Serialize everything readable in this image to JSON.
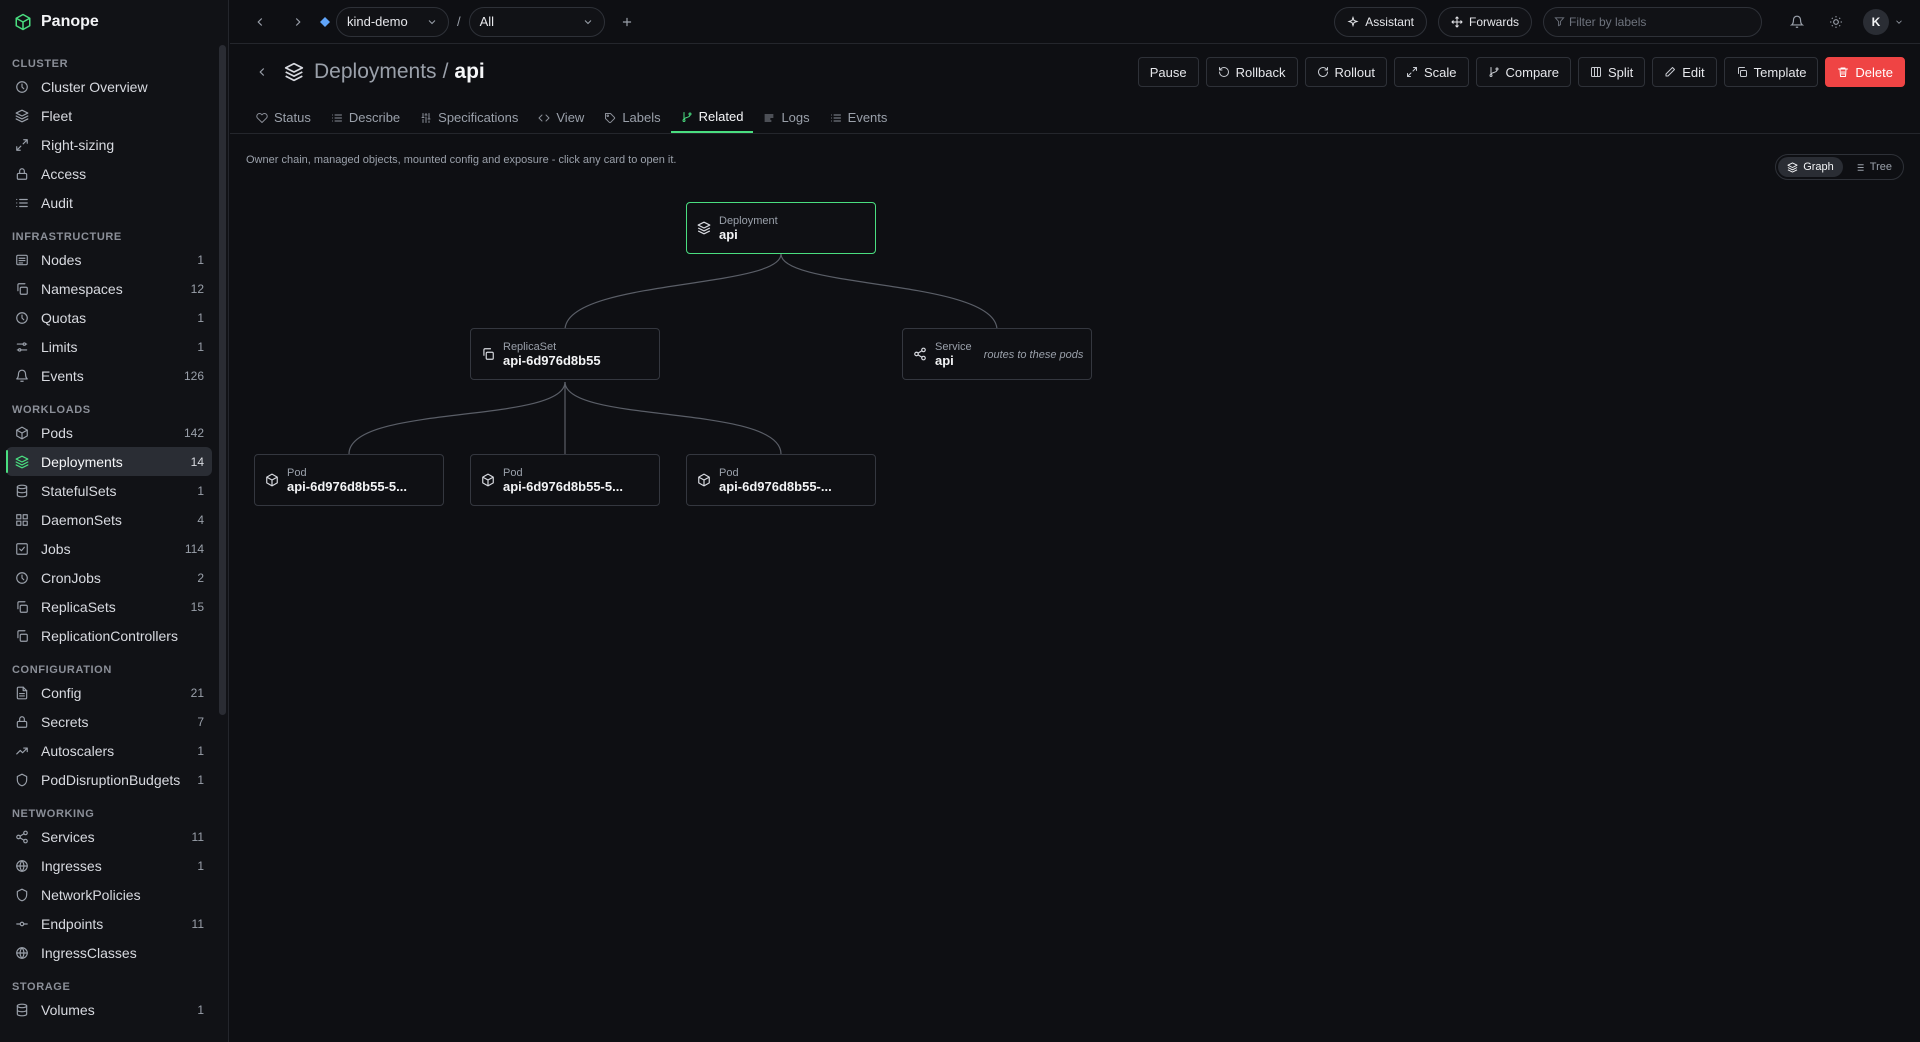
{
  "app": {
    "name": "Panope"
  },
  "sidebar": {
    "sections": [
      {
        "title": "CLUSTER",
        "items": [
          {
            "label": "Cluster Overview",
            "icon": "clock-icon",
            "count": ""
          },
          {
            "label": "Fleet",
            "icon": "layers-icon",
            "count": ""
          },
          {
            "label": "Right-sizing",
            "icon": "expand-icon",
            "count": ""
          },
          {
            "label": "Access",
            "icon": "lock-icon",
            "count": ""
          },
          {
            "label": "Audit",
            "icon": "list-icon",
            "count": ""
          }
        ]
      },
      {
        "title": "INFRASTRUCTURE",
        "items": [
          {
            "label": "Nodes",
            "icon": "server-icon",
            "count": "1"
          },
          {
            "label": "Namespaces",
            "icon": "copy-icon",
            "count": "12"
          },
          {
            "label": "Quotas",
            "icon": "clock-icon",
            "count": "1"
          },
          {
            "label": "Limits",
            "icon": "sliders-icon",
            "count": "1"
          },
          {
            "label": "Events",
            "icon": "bell-icon",
            "count": "126"
          }
        ]
      },
      {
        "title": "WORKLOADS",
        "items": [
          {
            "label": "Pods",
            "icon": "cube-icon",
            "count": "142"
          },
          {
            "label": "Deployments",
            "icon": "layers-icon",
            "count": "14",
            "active": true
          },
          {
            "label": "StatefulSets",
            "icon": "database-icon",
            "count": "1"
          },
          {
            "label": "DaemonSets",
            "icon": "grid-icon",
            "count": "4"
          },
          {
            "label": "Jobs",
            "icon": "check-square-icon",
            "count": "114"
          },
          {
            "label": "CronJobs",
            "icon": "clock-icon",
            "count": "2"
          },
          {
            "label": "ReplicaSets",
            "icon": "copy-icon",
            "count": "15"
          },
          {
            "label": "ReplicationControllers",
            "icon": "copy-icon",
            "count": ""
          }
        ]
      },
      {
        "title": "CONFIGURATION",
        "items": [
          {
            "label": "Config",
            "icon": "file-icon",
            "count": "21"
          },
          {
            "label": "Secrets",
            "icon": "lock-icon",
            "count": "7"
          },
          {
            "label": "Autoscalers",
            "icon": "trend-icon",
            "count": "1"
          },
          {
            "label": "PodDisruptionBudgets",
            "icon": "shield-icon",
            "count": "1"
          }
        ]
      },
      {
        "title": "NETWORKING",
        "items": [
          {
            "label": "Services",
            "icon": "share-icon",
            "count": "11"
          },
          {
            "label": "Ingresses",
            "icon": "globe-icon",
            "count": "1"
          },
          {
            "label": "NetworkPolicies",
            "icon": "shield-icon",
            "count": ""
          },
          {
            "label": "Endpoints",
            "icon": "dot-line-icon",
            "count": "11"
          },
          {
            "label": "IngressClasses",
            "icon": "globe-icon",
            "count": ""
          }
        ]
      },
      {
        "title": "STORAGE",
        "items": [
          {
            "label": "Volumes",
            "icon": "database-icon",
            "count": "1"
          }
        ]
      }
    ]
  },
  "topbar": {
    "cluster": "kind-demo",
    "separator": "/",
    "namespace": "All",
    "assistant_label": "Assistant",
    "forwards_label": "Forwards",
    "filter_placeholder": "Filter by labels",
    "avatar_initial": "K"
  },
  "header": {
    "resource_type": "Deployments",
    "separator": "/",
    "resource_name": "api",
    "actions": [
      {
        "label": "Pause",
        "icon": "",
        "variant": "default"
      },
      {
        "label": "Rollback",
        "icon": "rotate-ccw-icon",
        "variant": "default"
      },
      {
        "label": "Rollout",
        "icon": "refresh-icon",
        "variant": "default"
      },
      {
        "label": "Scale",
        "icon": "maximize-icon",
        "variant": "default"
      },
      {
        "label": "Compare",
        "icon": "git-branch-icon",
        "variant": "default"
      },
      {
        "label": "Split",
        "icon": "columns-icon",
        "variant": "default"
      },
      {
        "label": "Edit",
        "icon": "pencil-icon",
        "variant": "default"
      },
      {
        "label": "Template",
        "icon": "copy-icon",
        "variant": "default"
      },
      {
        "label": "Delete",
        "icon": "trash-icon",
        "variant": "danger"
      }
    ]
  },
  "tabs": [
    {
      "label": "Status",
      "icon": "heart-icon"
    },
    {
      "label": "Describe",
      "icon": "list-icon"
    },
    {
      "label": "Specifications",
      "icon": "sliders-v-icon"
    },
    {
      "label": "View",
      "icon": "code-icon"
    },
    {
      "label": "Labels",
      "icon": "tag-icon"
    },
    {
      "label": "Related",
      "icon": "git-branch-icon",
      "active": true
    },
    {
      "label": "Logs",
      "icon": "lines-icon"
    },
    {
      "label": "Events",
      "icon": "list-icon"
    }
  ],
  "related": {
    "hint": "Owner chain, managed objects, mounted config and exposure - click any card to open it.",
    "view_modes": [
      {
        "label": "Graph",
        "icon": "layers-icon",
        "active": true
      },
      {
        "label": "Tree",
        "icon": "list-icon",
        "active": false
      }
    ],
    "nodes": {
      "deployment": {
        "kind": "Deployment",
        "name": "api"
      },
      "replicaset": {
        "kind": "ReplicaSet",
        "name": "api-6d976d8b55"
      },
      "service": {
        "kind": "Service",
        "name": "api",
        "note": "routes to these pods"
      },
      "pod1": {
        "kind": "Pod",
        "name": "api-6d976d8b55-5..."
      },
      "pod2": {
        "kind": "Pod",
        "name": "api-6d976d8b55-5..."
      },
      "pod3": {
        "kind": "Pod",
        "name": "api-6d976d8b55-..."
      }
    }
  },
  "colors": {
    "accent": "#4ade80",
    "danger": "#ef4444",
    "background": "#0e0f13"
  }
}
